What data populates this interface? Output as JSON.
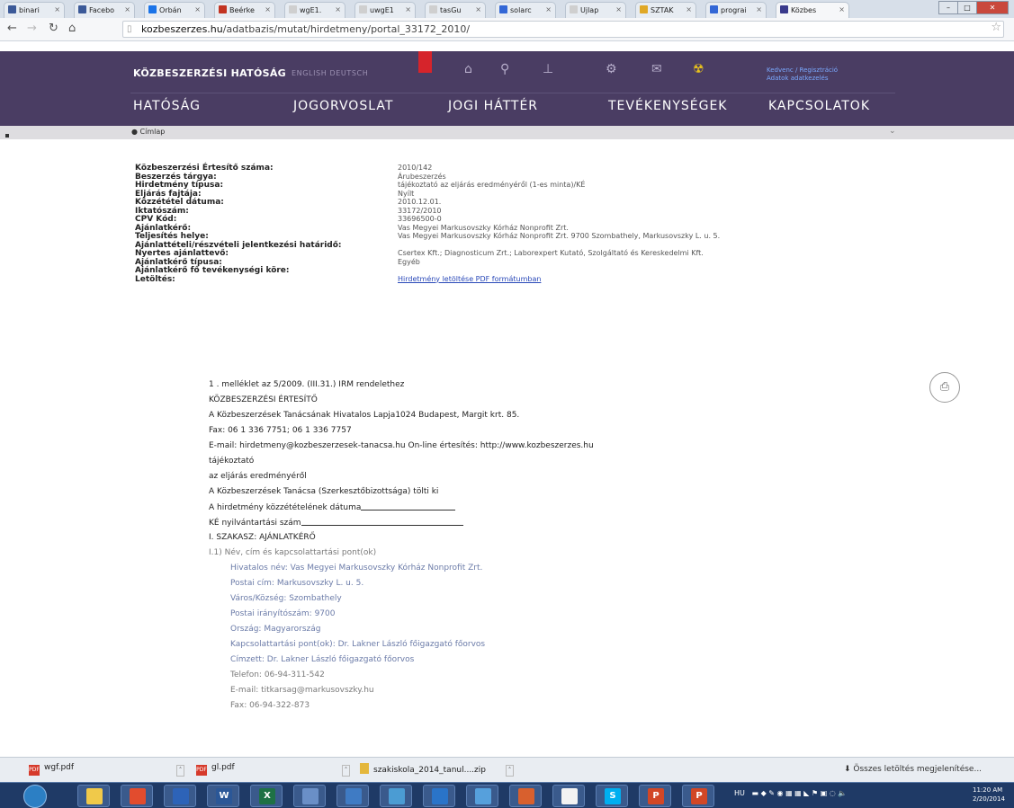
{
  "browser": {
    "tabs": [
      {
        "label": "binari",
        "color": "#3b5998"
      },
      {
        "label": "Facebo",
        "color": "#3b5998"
      },
      {
        "label": "Orbán",
        "color": "#1a73e8"
      },
      {
        "label": "Beérke",
        "color": "#c23321"
      },
      {
        "label": "wgE1.",
        "color": "#cfcfcf"
      },
      {
        "label": "uwgE1",
        "color": "#cfcfcf"
      },
      {
        "label": "tasGu",
        "color": "#cfcfcf"
      },
      {
        "label": "solarc",
        "color": "#3367d6"
      },
      {
        "label": "Ujlap",
        "color": "#cfcfcf"
      },
      {
        "label": "SZTAK",
        "color": "#e0a825"
      },
      {
        "label": "prograi",
        "color": "#3367d6"
      },
      {
        "label": "Közbes",
        "color": "#3a3a8c"
      }
    ],
    "url_domain": "kozbeszerzes.hu",
    "url_path": "/adatbazis/mutat/hirdetmeny/portal_33172_2010/"
  },
  "site": {
    "logo": "KÖZBESZERZÉSI HATÓSÁG",
    "languages": "ENGLISH  DEUTSCH",
    "favorites_link_line1": "Kedvenc / Regisztráció",
    "favorites_link_line2": "Adatok adatkezelés",
    "nav": [
      "HATÓSÁG",
      "JOGORVOSLAT",
      "JOGI HÁTTÉR",
      "TEVÉKENYSÉGEK",
      "KAPCSOLATOK"
    ],
    "breadcrumb": "● Címlap"
  },
  "meta_rows": [
    {
      "label": "Közbeszerzési Értesítő száma:",
      "value": "2010/142"
    },
    {
      "label": "Beszerzés tárgya:",
      "value": "Árubeszerzés"
    },
    {
      "label": "Hirdetmény típusa:",
      "value": "tájékoztató az eljárás eredményéről (1-es minta)/KÉ"
    },
    {
      "label": "Eljárás fajtája:",
      "value": "Nyílt"
    },
    {
      "label": "Közzététel dátuma:",
      "value": "2010.12.01."
    },
    {
      "label": "Iktatószám:",
      "value": "33172/2010"
    },
    {
      "label": "CPV Kód:",
      "value": "33696500-0"
    },
    {
      "label": "Ajánlatkérő:",
      "value": "Vas Megyei Markusovszky Kórház Nonprofit Zrt."
    },
    {
      "label": "Teljesítés helye:",
      "value": "Vas Megyei Markusovszky Kórház Nonprofit Zrt. 9700 Szombathely, Markusovszky L. u. 5."
    },
    {
      "label": "Ajánlattételi/részvételi jelentkezési határidő:",
      "value": ""
    },
    {
      "label": "Nyertes ajánlattevő:",
      "value": "Csertex Kft.; Diagnosticum Zrt.; Laborexpert Kutató, Szolgáltató és Kereskedelmi Kft."
    },
    {
      "label": "Ajánlatkérő típusa:",
      "value": "Egyéb"
    },
    {
      "label": "Ajánlatkérő fő tevékenységi köre:",
      "value": ""
    },
    {
      "label": "Letöltés:",
      "value": "Hirdetmény letöltése PDF formátumban",
      "link": true
    }
  ],
  "notice": {
    "lines": [
      {
        "text": "1 . melléklet az 5/2009. (III.31.) IRM rendelethez",
        "style": "nb",
        "indent": false
      },
      {
        "text": "KÖZBESZERZÉSI ÉRTESÍTŐ",
        "style": "nb",
        "indent": false
      },
      {
        "text": "A Közbeszerzések Tanácsának Hivatalos Lapja1024 Budapest, Margit krt. 85.",
        "style": "nb",
        "indent": false
      },
      {
        "text": "Fax: 06 1 336 7751; 06 1 336 7757",
        "style": "nb",
        "indent": false
      },
      {
        "text": "E-mail: hirdetmeny@kozbeszerzesek-tanacsa.hu On-line értesítés: http://www.kozbeszerzes.hu",
        "style": "nb",
        "indent": false
      },
      {
        "text": "tájékoztató",
        "style": "nb",
        "indent": false
      },
      {
        "text": "az eljárás eredményéről",
        "style": "nb",
        "indent": false
      },
      {
        "text": "A Közbeszerzések Tanácsa (Szerkesztőbizottsága) tölti ki",
        "style": "nb",
        "indent": false
      },
      {
        "text": "A hirdetmény közzétételének dátuma",
        "style": "nb",
        "indent": false,
        "underline": 105
      },
      {
        "text": "KÉ nyilvántartási szám",
        "style": "nb",
        "indent": false,
        "underline": 180
      },
      {
        "text": "I. SZAKASZ: AJÁNLATKÉRŐ",
        "style": "nb",
        "indent": false
      },
      {
        "text": "I.1) Név, cím és kapcsolattartási pont(ok)",
        "style": "ngray",
        "indent": false
      },
      {
        "text": "Hivatalos név: Vas Megyei Markusovszky Kórház Nonprofit Zrt.",
        "style": "nblue",
        "indent": true
      },
      {
        "text": "Postai cím: Markusovszky L. u. 5.",
        "style": "nblue",
        "indent": true
      },
      {
        "text": "Város/Község: Szombathely",
        "style": "nblue",
        "indent": true
      },
      {
        "text": "Postai irányítószám: 9700",
        "style": "nblue",
        "indent": true
      },
      {
        "text": "Ország: Magyarország",
        "style": "nblue",
        "indent": true
      },
      {
        "text": "Kapcsolattartási pont(ok): Dr. Lakner László főigazgató főorvos",
        "style": "nblue",
        "indent": true
      },
      {
        "text": "Címzett: Dr. Lakner László főigazgató főorvos",
        "style": "nblue",
        "indent": true
      },
      {
        "text": "Telefon: 06-94-311-542",
        "style": "ngray",
        "indent": true
      },
      {
        "text": "E-mail: titkarsag@markusovszky.hu",
        "style": "ngray",
        "indent": true
      },
      {
        "text": "Fax: 06-94-322-873",
        "style": "ngray",
        "indent": true
      }
    ]
  },
  "downloads": [
    {
      "name": "wgf.pdf",
      "kind": "pdf"
    },
    {
      "name": "gl.pdf",
      "kind": "pdf"
    },
    {
      "name": "szakiskola_2014_tanul....zip",
      "kind": "zip"
    }
  ],
  "downloads_show_all": "Összes letöltés megjelenítése...",
  "taskbar": {
    "apps": [
      {
        "glyph": "",
        "color": "#f0c94a"
      },
      {
        "glyph": "",
        "color": "#e24c2e"
      },
      {
        "glyph": "",
        "color": "#2d63b8"
      },
      {
        "glyph": "W",
        "color": "#2b5797"
      },
      {
        "glyph": "X",
        "color": "#1e7145"
      },
      {
        "glyph": "",
        "color": "#6a8fc7"
      },
      {
        "glyph": "",
        "color": "#3f7bc4"
      },
      {
        "glyph": "",
        "color": "#4b9cd3"
      },
      {
        "glyph": "",
        "color": "#2a74c9"
      },
      {
        "glyph": "",
        "color": "#56a0dc"
      },
      {
        "glyph": "",
        "color": "#d8602e"
      },
      {
        "glyph": "",
        "color": "#f2f2f2"
      },
      {
        "glyph": "S",
        "color": "#00aff0"
      },
      {
        "glyph": "P",
        "color": "#d24726"
      },
      {
        "glyph": "P",
        "color": "#d24726"
      }
    ],
    "lang": "HU",
    "time": "11:20 AM",
    "date": "2/20/2014"
  }
}
